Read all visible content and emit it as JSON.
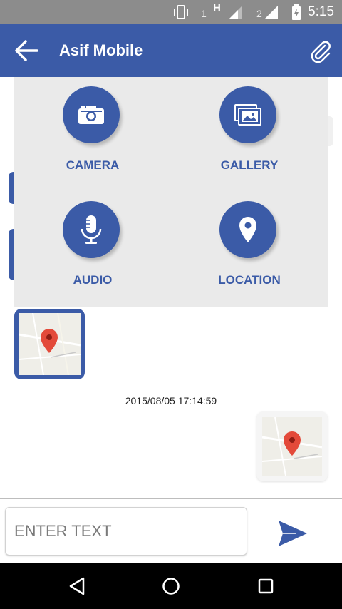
{
  "status_bar": {
    "sim1": "1",
    "network": "H",
    "sim2": "2",
    "time": "5:15"
  },
  "app_bar": {
    "title": "Asif Mobile",
    "back_icon": "arrow-left-icon",
    "attach_icon": "paperclip-icon"
  },
  "attachment_menu": {
    "options": [
      {
        "label": "CAMERA",
        "icon": "camera-icon"
      },
      {
        "label": "GALLERY",
        "icon": "gallery-icon"
      },
      {
        "label": "AUDIO",
        "icon": "microphone-icon"
      },
      {
        "label": "LOCATION",
        "icon": "location-pin-icon"
      }
    ]
  },
  "messages": {
    "timestamp": "2015/08/05 17:14:59"
  },
  "composer": {
    "placeholder": "ENTER TEXT",
    "send_icon": "send-icon"
  },
  "colors": {
    "primary": "#3b5ba7",
    "status_bar": "#8c8c8c",
    "panel_bg": "#eaeaea",
    "pin_red": "#e34a3a"
  }
}
